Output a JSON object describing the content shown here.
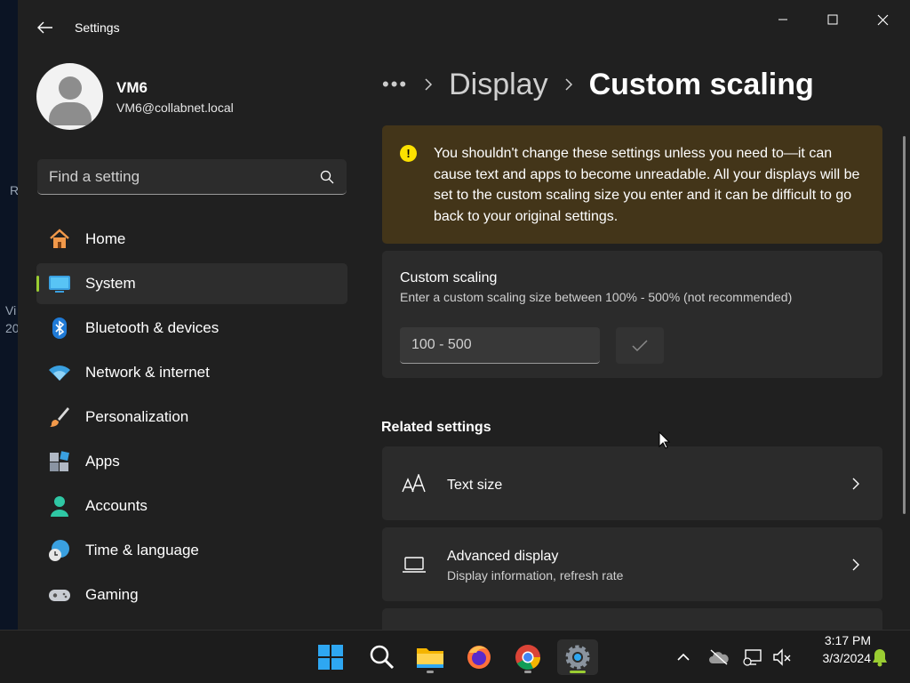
{
  "desktop": {
    "fragments": [
      "R",
      "Vi",
      "20"
    ]
  },
  "window": {
    "title": "Settings"
  },
  "profile": {
    "name": "VM6",
    "email": "VM6@collabnet.local"
  },
  "search": {
    "placeholder": "Find a setting"
  },
  "nav": {
    "selected": "System",
    "items": [
      {
        "label": "Home",
        "icon": "home-icon"
      },
      {
        "label": "System",
        "icon": "system-icon"
      },
      {
        "label": "Bluetooth & devices",
        "icon": "bluetooth-icon"
      },
      {
        "label": "Network & internet",
        "icon": "wifi-icon"
      },
      {
        "label": "Personalization",
        "icon": "brush-icon"
      },
      {
        "label": "Apps",
        "icon": "apps-icon"
      },
      {
        "label": "Accounts",
        "icon": "accounts-icon"
      },
      {
        "label": "Time & language",
        "icon": "globe-clock-icon"
      },
      {
        "label": "Gaming",
        "icon": "gamepad-icon"
      }
    ]
  },
  "breadcrumb": {
    "ellipsis": "•••",
    "parent": "Display",
    "current": "Custom scaling"
  },
  "warning": {
    "text": "You shouldn't change these settings unless you need to—it can cause text and apps to become unreadable. All your displays will be set to the custom scaling size you enter and it can be difficult to go back to your original settings."
  },
  "custom_scaling": {
    "title": "Custom scaling",
    "subtitle": "Enter a custom scaling size between 100% - 500% (not recommended)",
    "input_placeholder": "100 - 500",
    "input_value": ""
  },
  "related": {
    "heading": "Related settings",
    "items": [
      {
        "title": "Text size",
        "subtitle": ""
      },
      {
        "title": "Advanced display",
        "subtitle": "Display information, refresh rate"
      }
    ]
  },
  "taskbar": {
    "apps": [
      "start-icon",
      "search-icon",
      "file-explorer-icon",
      "firefox-icon",
      "chrome-icon",
      "settings-icon"
    ],
    "active_app": "settings-icon",
    "time": "3:17 PM",
    "date": "3/3/2024"
  },
  "colors": {
    "accent": "#9acd32",
    "warning_bg": "#433519",
    "warning_icon": "#fce100",
    "window_bg": "#202020",
    "card_bg": "#2b2b2b"
  }
}
